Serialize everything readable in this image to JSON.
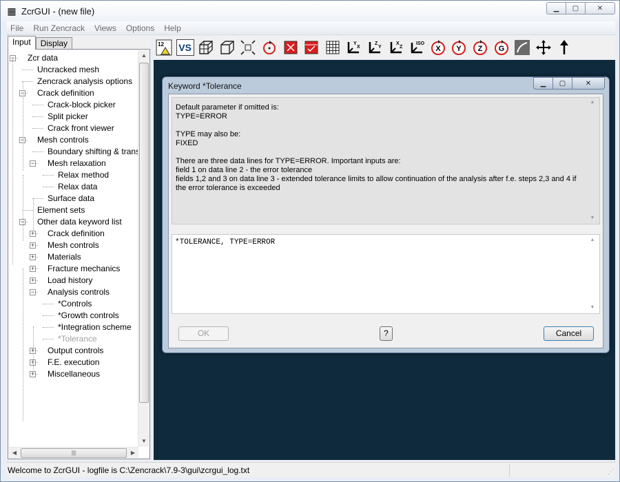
{
  "window": {
    "title": "ZcrGUI - (new file)",
    "app_icon": "grid-icon"
  },
  "menubar": {
    "items": [
      "File",
      "Run Zencrack",
      "Views",
      "Options",
      "Help"
    ]
  },
  "tabs": [
    "Input",
    "Display"
  ],
  "tree": [
    {
      "label": "Zcr data",
      "level": 0,
      "expander": "minus"
    },
    {
      "label": "Uncracked mesh",
      "level": 1,
      "expander": null
    },
    {
      "label": "Zencrack analysis options",
      "level": 1,
      "expander": null
    },
    {
      "label": "Crack definition",
      "level": 1,
      "expander": "minus"
    },
    {
      "label": "Crack-block picker",
      "level": 2,
      "expander": null
    },
    {
      "label": "Split picker",
      "level": 2,
      "expander": null
    },
    {
      "label": "Crack front viewer",
      "level": 2,
      "expander": null
    },
    {
      "label": "Mesh controls",
      "level": 1,
      "expander": "minus"
    },
    {
      "label": "Boundary shifting & trans",
      "level": 2,
      "expander": null
    },
    {
      "label": "Mesh relaxation",
      "level": 2,
      "expander": "minus"
    },
    {
      "label": "Relax method",
      "level": 3,
      "expander": null
    },
    {
      "label": "Relax data",
      "level": 3,
      "expander": null
    },
    {
      "label": "Surface data",
      "level": 2,
      "expander": null
    },
    {
      "label": "Element sets",
      "level": 1,
      "expander": null
    },
    {
      "label": "Other data keyword list",
      "level": 1,
      "expander": "minus"
    },
    {
      "label": "Crack definition",
      "level": 2,
      "expander": "plus"
    },
    {
      "label": "Mesh controls",
      "level": 2,
      "expander": "plus"
    },
    {
      "label": "Materials",
      "level": 2,
      "expander": "plus"
    },
    {
      "label": "Fracture mechanics",
      "level": 2,
      "expander": "plus"
    },
    {
      "label": "Load history",
      "level": 2,
      "expander": "plus"
    },
    {
      "label": "Analysis controls",
      "level": 2,
      "expander": "minus"
    },
    {
      "label": "*Controls",
      "level": 3,
      "expander": null
    },
    {
      "label": "*Growth controls",
      "level": 3,
      "expander": null
    },
    {
      "label": "*Integration scheme",
      "level": 3,
      "expander": null
    },
    {
      "label": "*Tolerance",
      "level": 3,
      "expander": null,
      "disabled": true
    },
    {
      "label": "Output controls",
      "level": 2,
      "expander": "plus"
    },
    {
      "label": "F.E. execution",
      "level": 2,
      "expander": "plus"
    },
    {
      "label": "Miscellaneous",
      "level": 2,
      "expander": "plus"
    }
  ],
  "toolbar": {
    "vs_label": "VS",
    "buttons": [
      {
        "name": "numbering-icon",
        "glyph": "12"
      },
      {
        "name": "vs-button",
        "glyph": "VS"
      },
      {
        "name": "mesh-cube-icon",
        "glyph": "cube"
      },
      {
        "name": "wire-cube-icon",
        "glyph": "cube2"
      },
      {
        "name": "fit-view-icon",
        "glyph": "fit"
      },
      {
        "name": "rotate-icon",
        "glyph": "rot"
      },
      {
        "name": "red-x-icon",
        "glyph": "redx"
      },
      {
        "name": "red-check-icon",
        "glyph": "redc"
      },
      {
        "name": "grid-icon",
        "glyph": "grid"
      },
      {
        "name": "view-yx-icon",
        "glyph": "YX"
      },
      {
        "name": "view-zy-icon",
        "glyph": "ZY"
      },
      {
        "name": "view-xz-icon",
        "glyph": "XZ"
      },
      {
        "name": "view-iso-icon",
        "glyph": "ISO"
      },
      {
        "name": "rotate-x-icon",
        "glyph": "X"
      },
      {
        "name": "rotate-y-icon",
        "glyph": "Y"
      },
      {
        "name": "rotate-z-icon",
        "glyph": "Z"
      },
      {
        "name": "rotate-g-icon",
        "glyph": "G"
      },
      {
        "name": "curve-icon",
        "glyph": "curve"
      },
      {
        "name": "pan-icon",
        "glyph": "pan"
      },
      {
        "name": "up-arrow-icon",
        "glyph": "up"
      }
    ]
  },
  "dialog": {
    "title": "Keyword *Tolerance",
    "info_text": "Default parameter if omitted is:\nTYPE=ERROR\n\nTYPE may also be:\nFIXED\n\nThere are three data lines for TYPE=ERROR. Important inputs are:\nfield 1 on data line 2 - the error tolerance\nfields 1,2 and 3 on data line 3 - extended tolerance limits to allow continuation of the analysis after f.e. steps 2,3 and 4 if the error tolerance is exceeded",
    "editor_text": "*TOLERANCE, TYPE=ERROR",
    "ok_label": "OK",
    "help_label": "?",
    "cancel_label": "Cancel"
  },
  "statusbar": {
    "text": "Welcome to ZcrGUI - logfile is C:\\Zencrack\\7.9-3\\gui\\zcrgui_log.txt"
  },
  "colors": {
    "canvas_bg": "#0f2a3c",
    "red_icon": "#d81e1e"
  }
}
